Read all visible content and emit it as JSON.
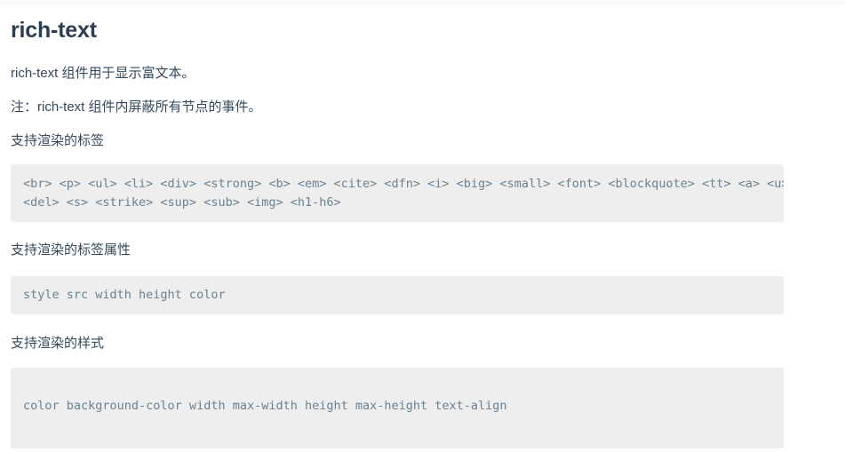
{
  "page": {
    "title": "rich-text",
    "paragraphs": [
      "rich-text 组件用于显示富文本。",
      "注：rich-text 组件内屏蔽所有节点的事件。"
    ],
    "sections": [
      {
        "label": "支持渲染的标签",
        "code_lines": [
          "<br> <p> <ul> <li> <div> <strong> <b> <em> <cite> <dfn> <i> <big> <small> <font> <blockquote> <tt> <a> <u>",
          "<del> <s> <strike> <sup> <sub> <img> <h1-h6>"
        ]
      },
      {
        "label": "支持渲染的标签属性",
        "code_lines": [
          "style src width height color"
        ]
      },
      {
        "label": "支持渲染的样式",
        "code_lines": [
          "",
          "color background-color width max-width height max-height text-align"
        ]
      }
    ]
  },
  "colors": {
    "page_background": "#ffffff",
    "heading_text": "#2c3e50",
    "body_text": "#34495e",
    "code_background": "#eeeeee",
    "code_text": "#6a8292"
  }
}
